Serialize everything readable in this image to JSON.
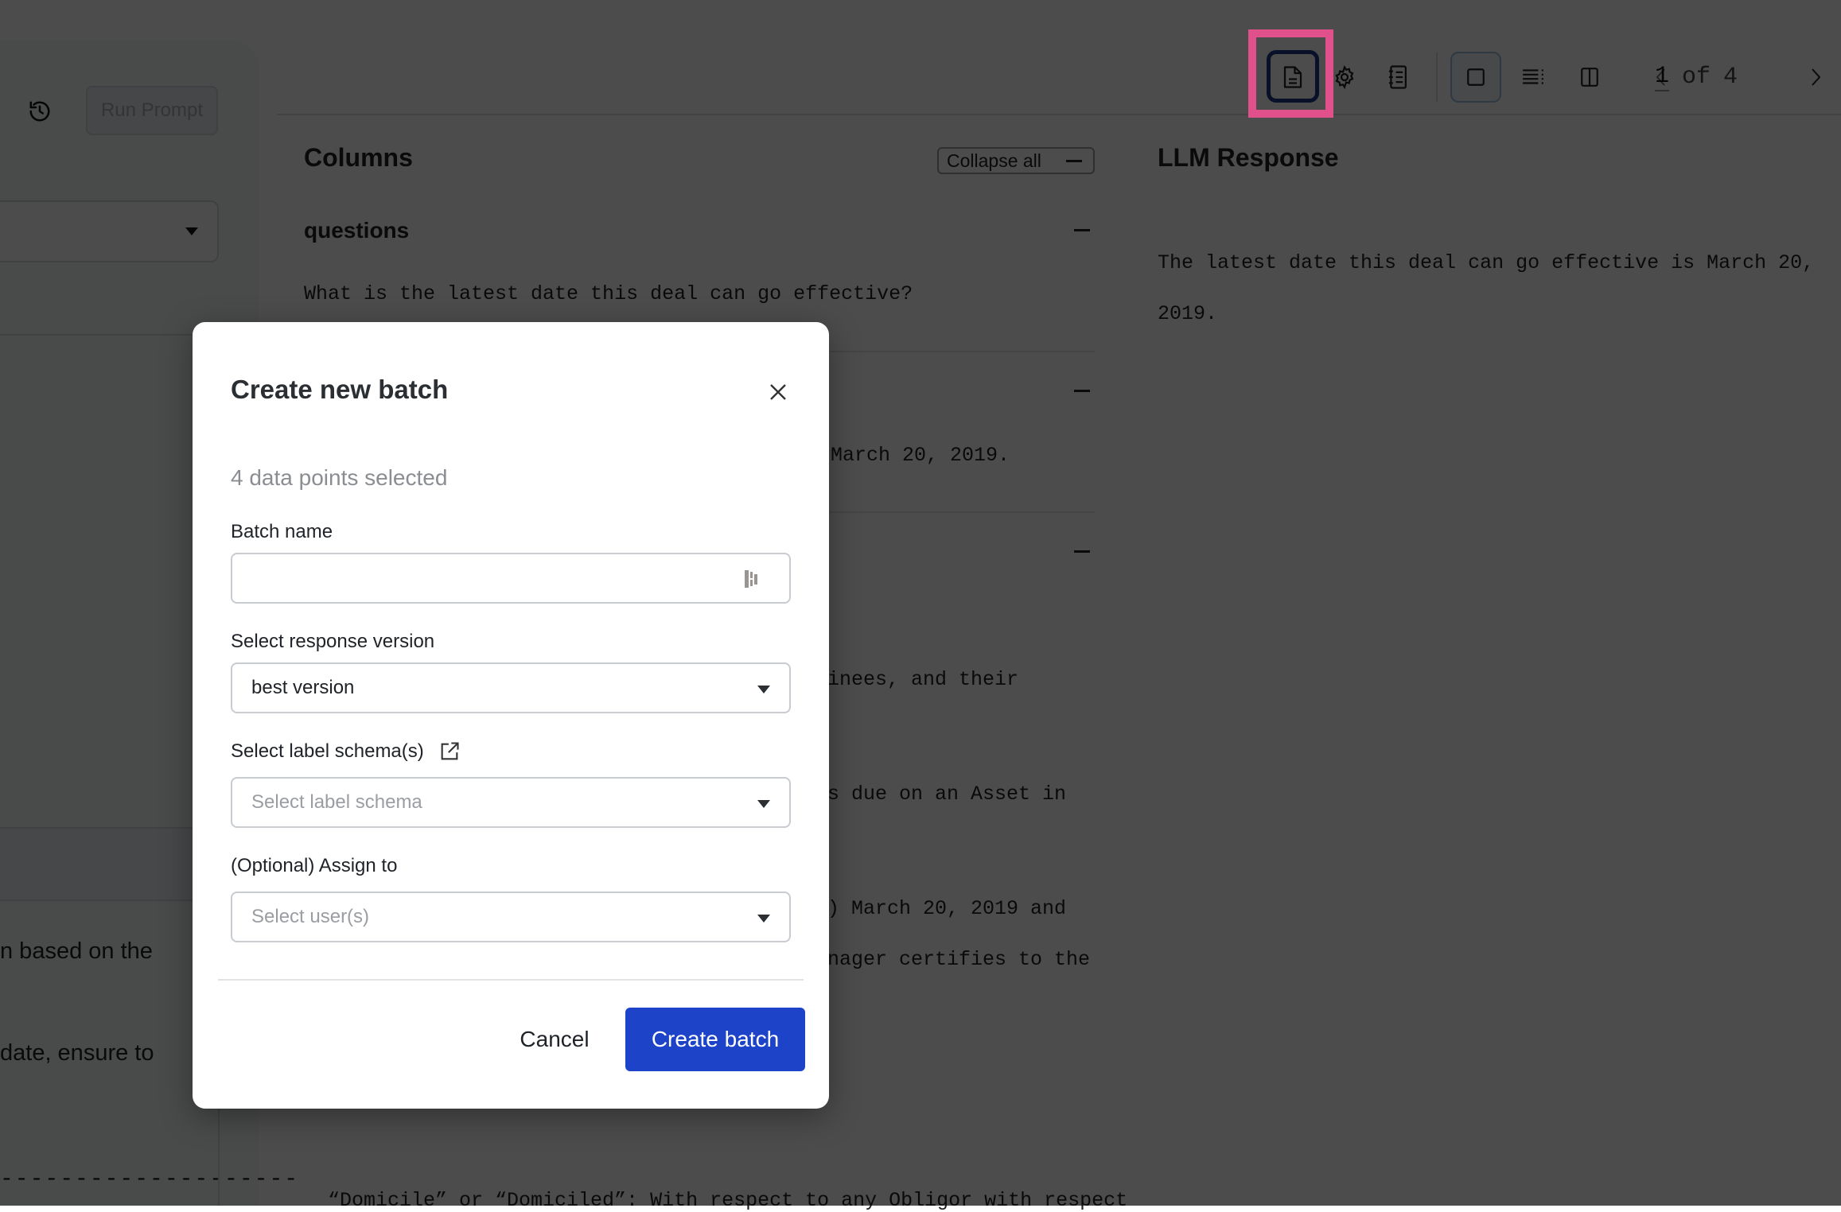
{
  "left_panel": {
    "run_prompt_label": "Run Prompt",
    "text_line_1": "n based on the",
    "text_line_2": " date, ensure to",
    "dashes": "--------------------"
  },
  "toolbar": {
    "icons": [
      "document-icon",
      "settings-icon",
      "notebook-icon",
      "single-view-icon",
      "list-view-icon",
      "split-view-icon"
    ],
    "active_icon": "document-icon",
    "active_view": "single-view-icon",
    "pager": {
      "current": "1",
      "of_label": "of",
      "total": "4"
    },
    "highlight_color": "#e0508a"
  },
  "columns_panel": {
    "title": "Columns",
    "collapse_all_label": "Collapse all",
    "rows": [
      {
        "title": "questions",
        "text": "What is the latest date this deal can go effective?"
      },
      {
        "title": "",
        "text": "March 20, 2019."
      },
      {
        "title": "",
        "lines": [
          "inees, and their",
          "s due on an Asset in",
          ") March 20, 2019 and",
          "nager certifies to the"
        ]
      }
    ],
    "footer_text": "“Domicile” or “Domiciled”: With respect to any Obligor with respect"
  },
  "response_panel": {
    "title": "LLM Response",
    "line_1": "The latest date this deal can go effective is March 20,",
    "line_2": "2019."
  },
  "modal": {
    "title": "Create new batch",
    "selected_count_text": "4 data points selected",
    "batch_name": {
      "label": "Batch name",
      "value": "",
      "placeholder": ""
    },
    "response_version": {
      "label": "Select response version",
      "value": "best version"
    },
    "label_schema": {
      "label": "Select label schema(s)",
      "placeholder": "Select label schema"
    },
    "assign_to": {
      "label": "(Optional) Assign to",
      "placeholder": "Select user(s)"
    },
    "cancel_label": "Cancel",
    "create_label": "Create batch",
    "primary_color": "#1d43c9"
  }
}
